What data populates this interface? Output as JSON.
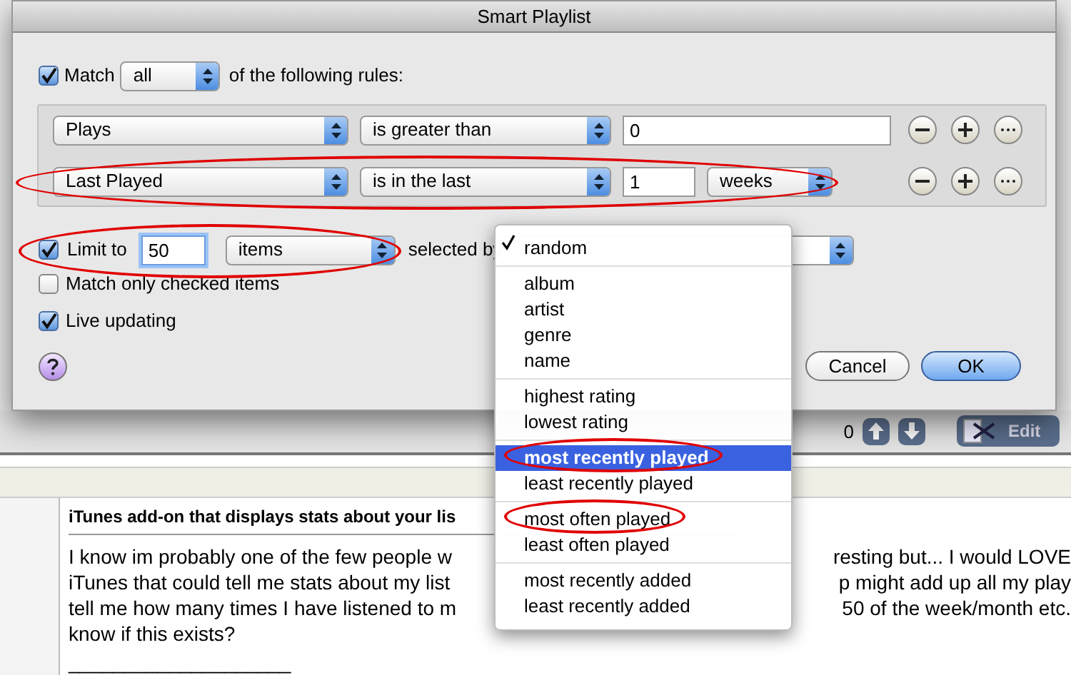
{
  "dialog": {
    "title": "Smart Playlist",
    "match": {
      "checked": true,
      "label": "Match",
      "value": "all",
      "suffix": "of the following rules:"
    },
    "rules": [
      {
        "field": "Plays",
        "operator": "is greater than",
        "value": "0",
        "circled": false
      },
      {
        "field": "Last Played",
        "operator": "is in the last",
        "value": "1",
        "unit": "weeks",
        "circled": true
      }
    ],
    "limit": {
      "checked": true,
      "label": "Limit to",
      "value": "50",
      "unit": "items",
      "selected_by_label": "selected by",
      "circled": true
    },
    "options": [
      {
        "label": "Match only checked items",
        "checked": false
      },
      {
        "label": "Live updating",
        "checked": true
      }
    ],
    "buttons": [
      {
        "label": "Cancel",
        "default": false
      },
      {
        "label": "OK",
        "default": true
      }
    ]
  },
  "menu": {
    "groups": [
      [
        {
          "label": "random",
          "checked": true,
          "selected": false,
          "circled": false
        }
      ],
      [
        {
          "label": "album",
          "checked": false,
          "selected": false,
          "circled": false
        },
        {
          "label": "artist",
          "checked": false,
          "selected": false,
          "circled": false
        },
        {
          "label": "genre",
          "checked": false,
          "selected": false,
          "circled": false
        },
        {
          "label": "name",
          "checked": false,
          "selected": false,
          "circled": false
        }
      ],
      [
        {
          "label": "highest rating",
          "checked": false,
          "selected": false,
          "circled": false
        },
        {
          "label": "lowest rating",
          "checked": false,
          "selected": false,
          "circled": false
        }
      ],
      [
        {
          "label": "most recently played",
          "checked": false,
          "selected": true,
          "circled": true
        },
        {
          "label": "least recently played",
          "checked": false,
          "selected": false,
          "circled": false
        }
      ],
      [
        {
          "label": "most often played",
          "checked": false,
          "selected": false,
          "circled": true
        },
        {
          "label": "least often played",
          "checked": false,
          "selected": false,
          "circled": false
        }
      ],
      [
        {
          "label": "most recently added",
          "checked": false,
          "selected": false,
          "circled": false
        },
        {
          "label": "least recently added",
          "checked": false,
          "selected": false,
          "circled": false
        }
      ]
    ]
  },
  "toolbar": {
    "count": "0",
    "edit_label": "Edit"
  },
  "post": {
    "title": "iTunes add-on that displays stats about your lis",
    "lines": [
      {
        "left": "I know im probably one of the few people w",
        "right": "resting but... I would LOVE"
      },
      {
        "left": "iTunes that could tell me stats about my list",
        "right": "p might add up all my play"
      },
      {
        "left": "tell me how many times I have listened to m",
        "right": "50 of the week/month etc."
      },
      {
        "left": "know if this exists?"
      }
    ],
    "signature_rule": "____________________"
  }
}
